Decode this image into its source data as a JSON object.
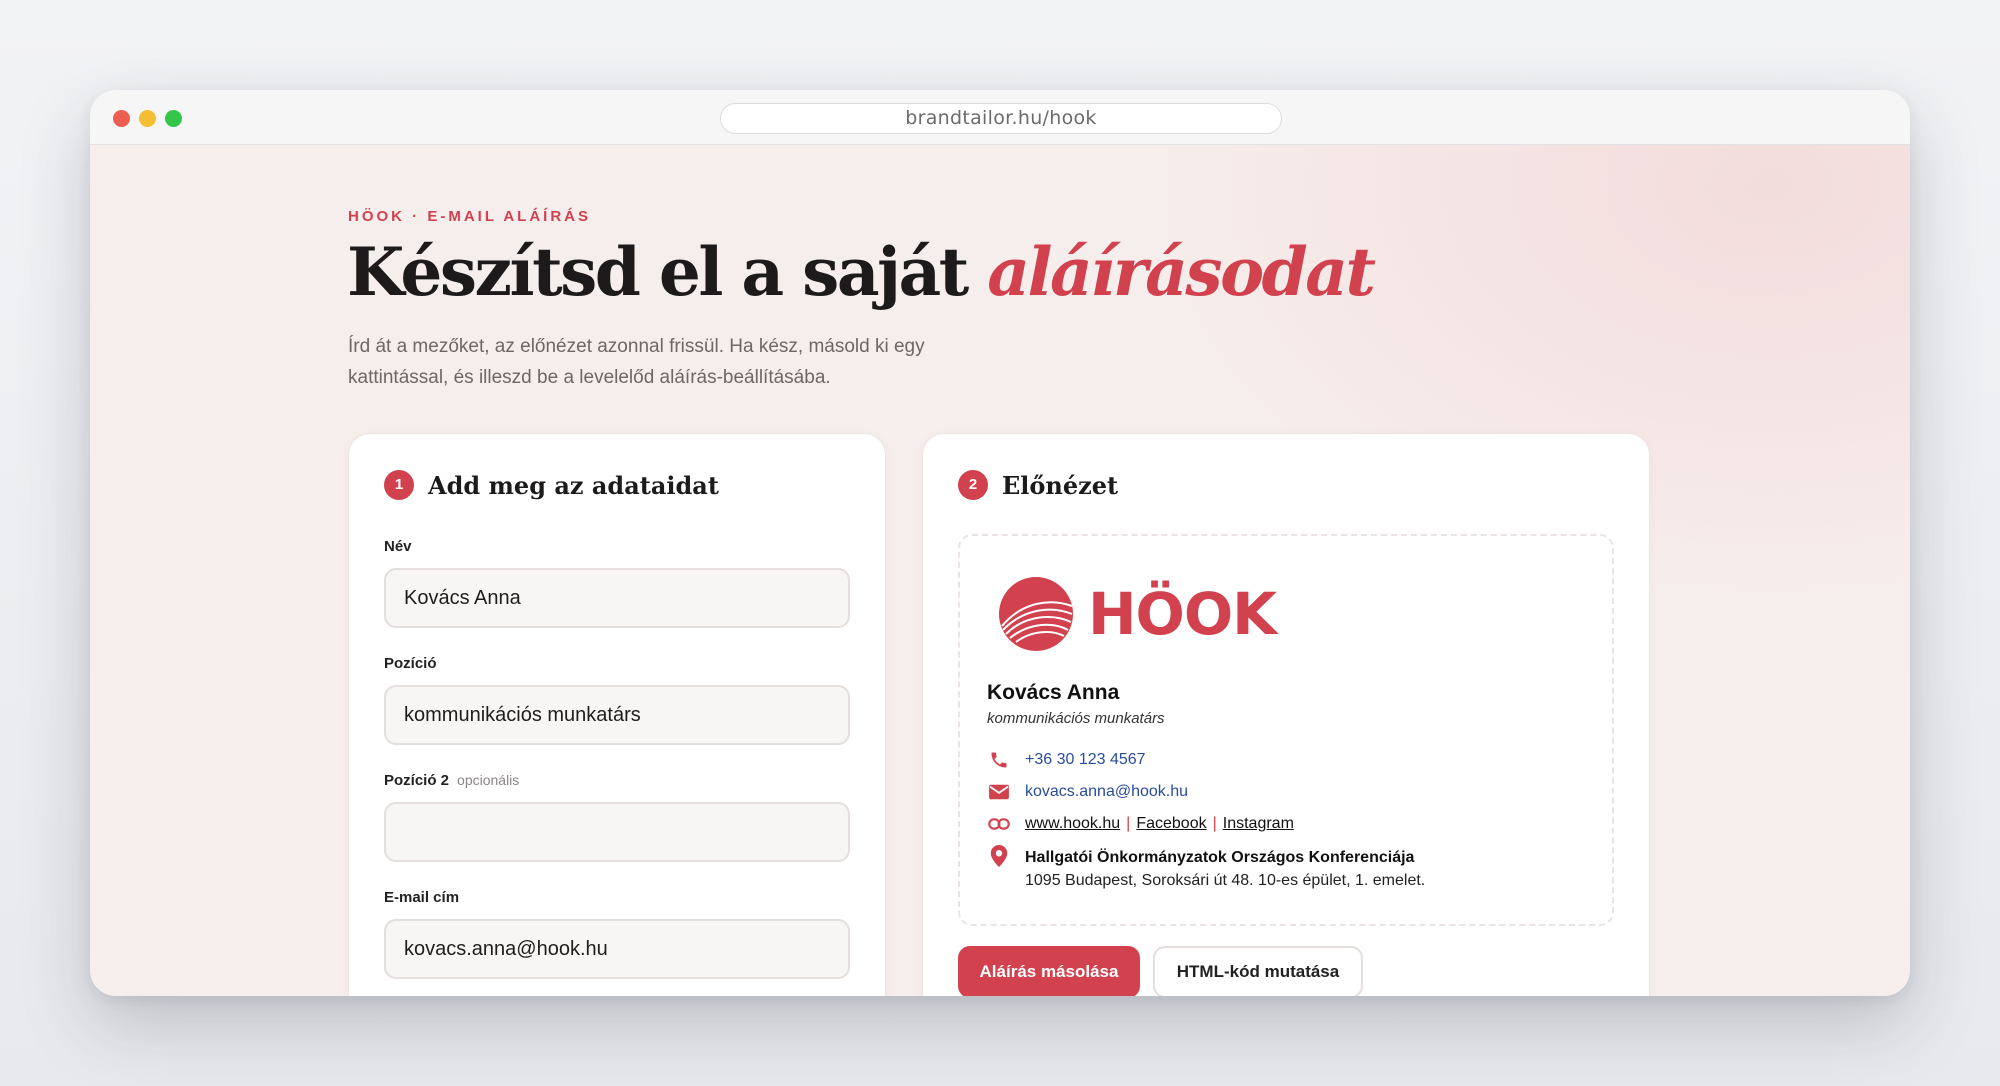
{
  "browser": {
    "url": "brandtailor.hu/hook"
  },
  "page": {
    "eyebrow": "HÖOK · E-MAIL ALÁÍRÁS",
    "title_main": "Készítsd el a saját ",
    "title_accent": "aláírásodat",
    "subtitle_line1": "Írd át a mezőket, az előnézet azonnal frissül. Ha kész, másold ki egy",
    "subtitle_line2": "kattintással, és illeszd be a levelelőd aláírás-beállításába."
  },
  "form": {
    "step": "1",
    "title": "Add meg az adataidat",
    "fields": [
      {
        "label": "Név",
        "value": "Kovács Anna",
        "optional": ""
      },
      {
        "label": "Pozíció",
        "value": "kommunikációs munkatárs",
        "optional": ""
      },
      {
        "label": "Pozíció 2",
        "value": "",
        "optional": "opcionális"
      },
      {
        "label": "E-mail cím",
        "value": "kovacs.anna@hook.hu",
        "optional": ""
      }
    ]
  },
  "preview": {
    "step": "2",
    "title": "Előnézet",
    "logo_text": "HÖOK",
    "name": "Kovács Anna",
    "role": "kommunikációs munkatárs",
    "phone": "+36 30 123 4567",
    "email": "kovacs.anna@hook.hu",
    "links": [
      "www.hook.hu",
      "Facebook",
      "Instagram"
    ],
    "link_separator": "|",
    "organization": "Hallgatói Önkormányzatok Országos Konferenciája",
    "address": "1095 Budapest, Soroksári út 48. 10-es épület, 1. emelet.",
    "copy_button": "Aláírás másolása",
    "html_button": "HTML-kód mutatása"
  },
  "icons": {
    "phone": "phone-icon",
    "email": "mail-icon",
    "link": "link-icon",
    "location": "location-pin-icon",
    "logo": "hook-logo-icon"
  },
  "colors": {
    "accent": "#d1414e",
    "link_blue": "#2a4d9b",
    "background": "#f6eeec"
  }
}
